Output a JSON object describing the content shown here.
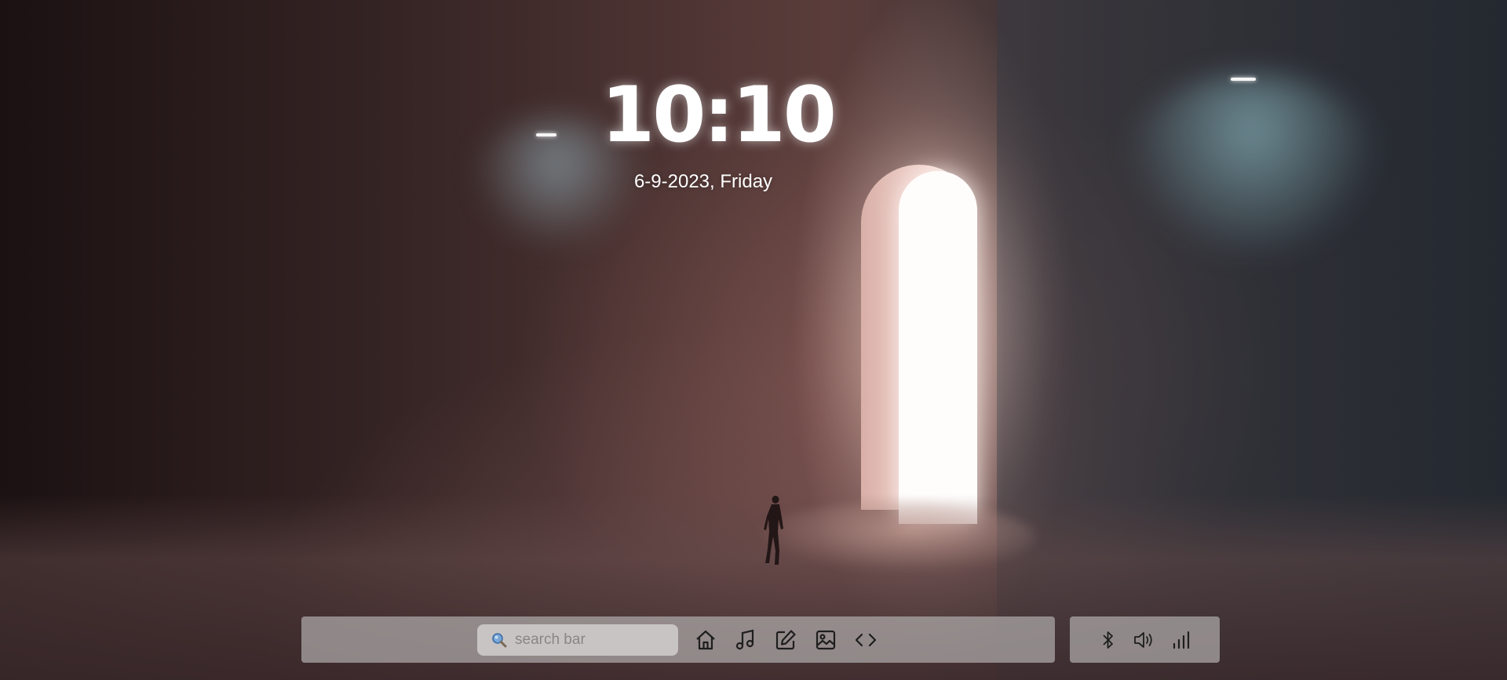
{
  "clock": {
    "time": "10:10",
    "date": "6-9-2023, Friday"
  },
  "taskbar": {
    "search": {
      "placeholder": "search bar",
      "icon": "magnifier-icon"
    },
    "apps": [
      {
        "name": "home",
        "icon": "home-icon"
      },
      {
        "name": "music",
        "icon": "music-note-icon"
      },
      {
        "name": "notes",
        "icon": "edit-icon"
      },
      {
        "name": "gallery",
        "icon": "image-icon"
      },
      {
        "name": "code",
        "icon": "code-brackets-icon"
      }
    ]
  },
  "tray": {
    "items": [
      {
        "name": "bluetooth",
        "icon": "bluetooth-icon"
      },
      {
        "name": "volume",
        "icon": "speaker-icon"
      },
      {
        "name": "signal",
        "icon": "signal-bars-icon"
      }
    ]
  },
  "colors": {
    "taskbar_bg": "#afaaaa",
    "search_bg": "#cdc9c9",
    "icon_color": "#1e1e1e",
    "clock_text": "#ffffff"
  }
}
